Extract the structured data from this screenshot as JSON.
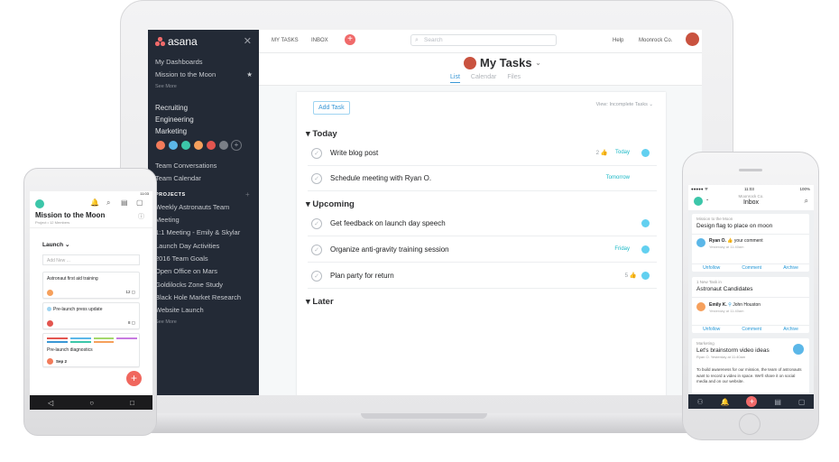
{
  "laptop": {
    "sidebar": {
      "brand": "asana",
      "close": "✕",
      "favorites": [
        "My Dashboards",
        "Mission to the Moon"
      ],
      "see_more_1": "See More",
      "teams": [
        "Recruiting",
        "Engineering",
        "Marketing"
      ],
      "links": [
        "Team Conversations",
        "Team Calendar"
      ],
      "projects_header": "PROJECTS",
      "projects": [
        "Weekly Astronauts Team",
        "Meeting",
        "1:1 Meeting - Emily & Skylar",
        "Launch Day Activities",
        "2016 Team Goals",
        "Open Office on Mars",
        "Goldilocks Zone Study",
        "Black Hole Market Research",
        "Website Launch"
      ],
      "see_more_2": "See More",
      "avatar_colors": [
        "#f27b5a",
        "#5bb7e8",
        "#3cc6a9",
        "#f6a05c",
        "#e3554f",
        "#7a7f87"
      ]
    },
    "topbar": {
      "my_tasks": "MY TASKS",
      "inbox": "INBOX",
      "search_placeholder": "Search",
      "help": "Help",
      "org": "Moonrock Co."
    },
    "header": {
      "title": "My Tasks",
      "tabs": [
        "List",
        "Calendar",
        "Files"
      ]
    },
    "content": {
      "add_task": "Add Task",
      "view": "View: Incomplete Tasks",
      "sections": {
        "today": "Today",
        "upcoming": "Upcoming",
        "later": "Later"
      },
      "today_tasks": [
        {
          "name": "Write blog post",
          "likes": "2",
          "due": "Today"
        },
        {
          "name": "Schedule meeting with Ryan O.",
          "due": "Tomorrow"
        }
      ],
      "upcoming_tasks": [
        {
          "name": "Get feedback on launch day speech"
        },
        {
          "name": "Organize anti-gravity training session",
          "due": "Friday"
        },
        {
          "name": "Plan party for return",
          "likes": "5"
        }
      ]
    }
  },
  "android": {
    "status_time": "11:03",
    "project_title": "Mission to the Moon",
    "project_sub": "Project • 12 Members",
    "section": "Launch",
    "add_new": "Add New ...",
    "cards": [
      {
        "title": "Astronaut first aid training",
        "count": "12"
      },
      {
        "title": "Pre-launch press update",
        "count": "8"
      },
      {
        "title": "Pre-launch diagnostics",
        "due": "Sep 2"
      }
    ],
    "fab": "+",
    "nav": [
      "◁",
      "○",
      "□"
    ]
  },
  "iphone": {
    "time": "11:03",
    "battery": "100%",
    "org": "Moonrock Co.",
    "title": "Inbox",
    "items": [
      {
        "context": "Mission to the Moon",
        "title": "Design flag to place on moon",
        "actor": "Ryan O.",
        "action": "your comment",
        "time": "Yesterday at 11:40am"
      },
      {
        "context": "1 New Task in",
        "title": "Astronaut Candidates",
        "actor": "Emily K.",
        "action": "John Houston",
        "time": "Yesterday at 11:40am"
      },
      {
        "context": "Marketing",
        "title": "Let's brainstorm video ideas",
        "actor": "Ryan O.",
        "time": "Yesterday at 11:40am",
        "body": "To build awareness for our mission, the team of astronauts want to record a video in space. We'll share it on social media and on our website."
      }
    ],
    "actions": [
      "Unfollow",
      "Comment",
      "Archive"
    ]
  }
}
